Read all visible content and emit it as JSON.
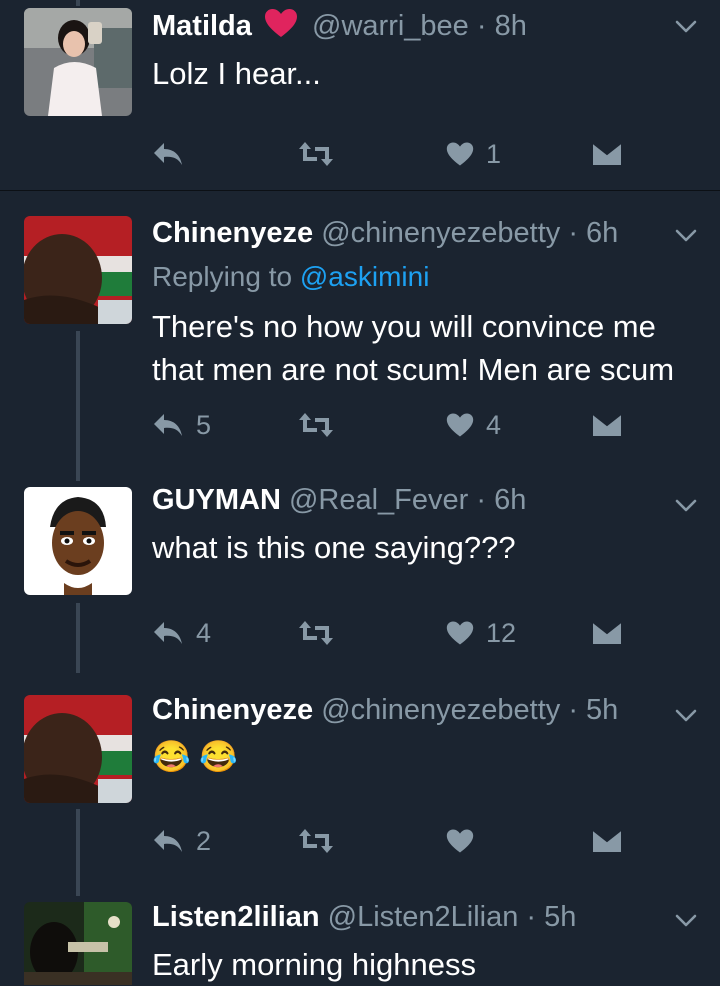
{
  "tweets": [
    {
      "name": "Matilda",
      "handle": "@warri_bee",
      "time": "· 8h",
      "text": "Lolz I hear...",
      "reply_count": "",
      "like_count": "1"
    },
    {
      "name": "Chinenyeze",
      "handle": "@chinenyezebetty",
      "time": "· 6h",
      "replying_label": "Replying to",
      "replying_handle": "@askimini",
      "text": "There's no how you will convince me that men are not scum! Men are scum",
      "reply_count": "5",
      "like_count": "4"
    },
    {
      "name": "GUYMAN",
      "handle": "@Real_Fever",
      "time": "· 6h",
      "text": "what is this one saying???",
      "reply_count": "4",
      "like_count": "12"
    },
    {
      "name": "Chinenyeze",
      "handle": "@chinenyezebetty",
      "time": "· 5h",
      "text": "😂 😂",
      "reply_count": "2",
      "like_count": ""
    },
    {
      "name": "Listen2lilian",
      "handle": "@Listen2Lilian",
      "time": "· 5h",
      "text": "Early morning highness"
    }
  ],
  "icons": {
    "reply": "reply-icon",
    "retweet": "retweet-icon",
    "like": "heart-icon",
    "dm": "direct-message-icon",
    "more": "chevron-down-icon",
    "badge": "pink-heart-icon"
  },
  "colors": {
    "background": "#1b2430",
    "secondary_text": "#8899a6",
    "link": "#1da1f2",
    "heart_badge": "#e0245e"
  }
}
